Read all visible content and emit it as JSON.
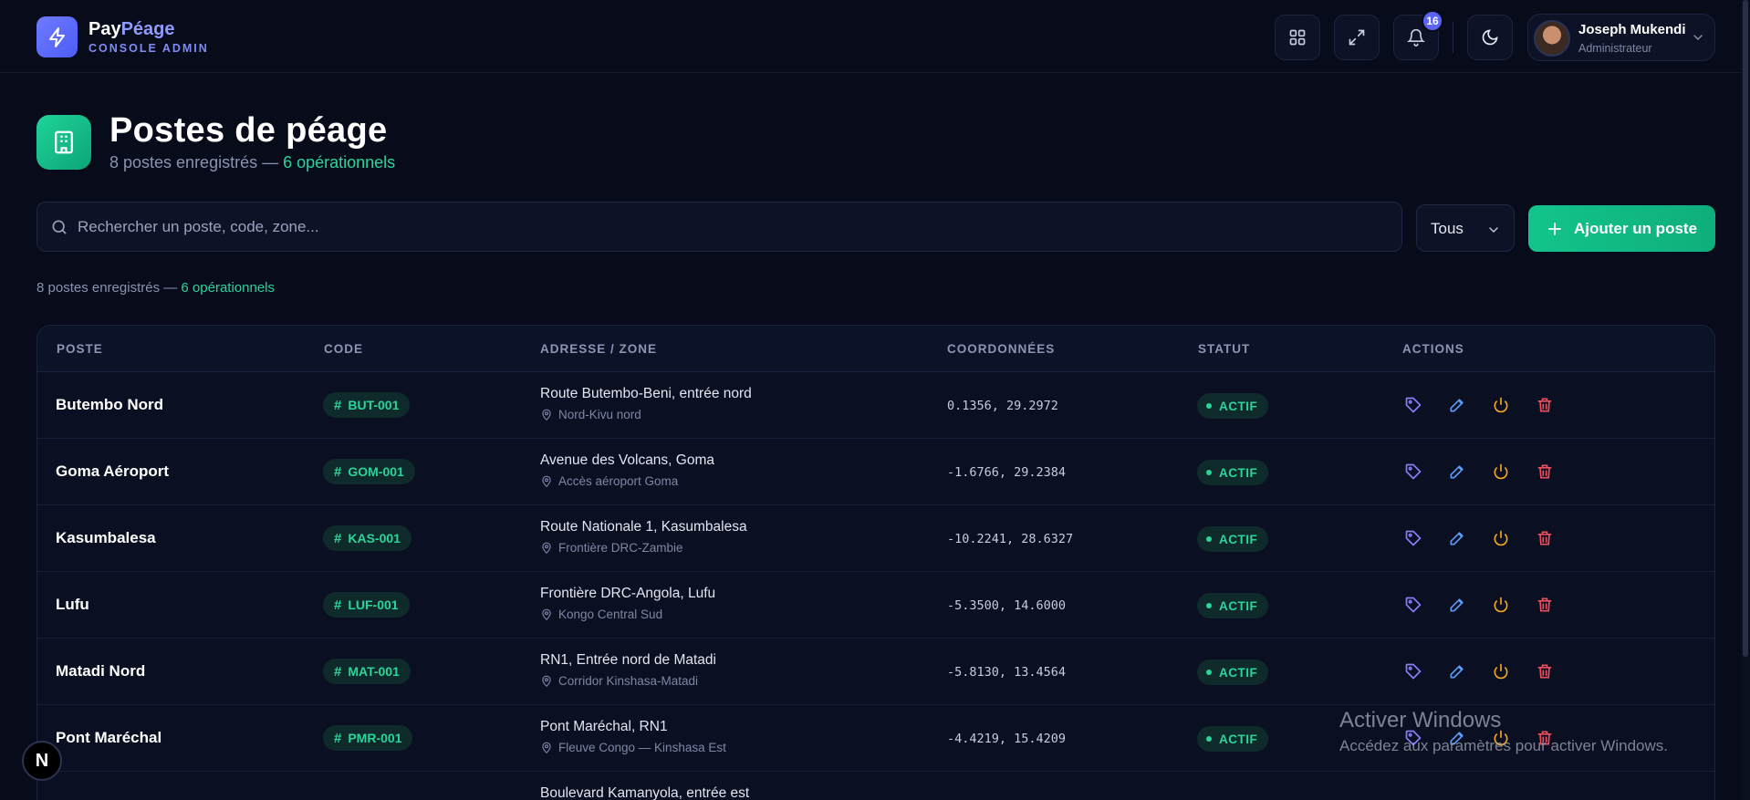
{
  "brand": {
    "name_part1": "Pay",
    "name_part2": "Péage",
    "subtitle": "CONSOLE ADMIN",
    "icon": "bolt-icon"
  },
  "header": {
    "notifications_count": "16",
    "user": {
      "name": "Joseph Mukendi",
      "role": "Administrateur"
    }
  },
  "page": {
    "title": "Postes de péage",
    "subtitle_count": "8 postes enregistrés — ",
    "subtitle_active": "6 opérationnels"
  },
  "toolbar": {
    "search_placeholder": "Rechercher un poste, code, zone...",
    "filter_value": "Tous",
    "add_label": "Ajouter un poste"
  },
  "summary": {
    "count": "8 postes enregistrés — ",
    "active": "6 opérationnels"
  },
  "table": {
    "columns": [
      "POSTE",
      "CODE",
      "ADRESSE / ZONE",
      "COORDONNÉES",
      "STATUT",
      "ACTIONS"
    ],
    "rows": [
      {
        "name": "Butembo Nord",
        "code": "BUT-001",
        "address": "Route Butembo-Beni, entrée nord",
        "zone": "Nord-Kivu nord",
        "coords": "0.1356, 29.2972",
        "status": "ACTIF"
      },
      {
        "name": "Goma Aéroport",
        "code": "GOM-001",
        "address": "Avenue des Volcans, Goma",
        "zone": "Accès aéroport Goma",
        "coords": "-1.6766, 29.2384",
        "status": "ACTIF"
      },
      {
        "name": "Kasumbalesa",
        "code": "KAS-001",
        "address": "Route Nationale 1, Kasumbalesa",
        "zone": "Frontière DRC-Zambie",
        "coords": "-10.2241, 28.6327",
        "status": "ACTIF"
      },
      {
        "name": "Lufu",
        "code": "LUF-001",
        "address": "Frontière DRC-Angola, Lufu",
        "zone": "Kongo Central Sud",
        "coords": "-5.3500, 14.6000",
        "status": "ACTIF"
      },
      {
        "name": "Matadi Nord",
        "code": "MAT-001",
        "address": "RN1, Entrée nord de Matadi",
        "zone": "Corridor Kinshasa-Matadi",
        "coords": "-5.8130, 13.4564",
        "status": "ACTIF"
      },
      {
        "name": "Pont Maréchal",
        "code": "PMR-001",
        "address": "Pont Maréchal, RN1",
        "zone": "Fleuve Congo — Kinshasa Est",
        "coords": "-4.4219, 15.4209",
        "status": "ACTIF"
      },
      {
        "name": "",
        "code": "",
        "address": "Boulevard Kamanyola, entrée est",
        "zone": "",
        "coords": "",
        "status": ""
      }
    ]
  },
  "watermark": {
    "title": "Activer Windows",
    "subtitle": "Accédez aux paramètres pour activer Windows."
  },
  "floating": {
    "next_label": "N"
  },
  "colors": {
    "accent_green": "#2ad59b",
    "accent_indigo": "#6e7bff",
    "background": "#070b1a"
  }
}
